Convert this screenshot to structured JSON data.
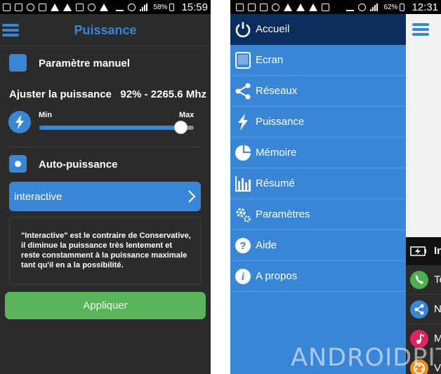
{
  "left_phone": {
    "status_bar": {
      "battery": "58%",
      "time": "15:59"
    },
    "app_bar": {
      "title": "Puissance"
    },
    "manual_option": {
      "label": "Paramètre manuel"
    },
    "power": {
      "label": "Ajuster la puissance",
      "value": "92% - 2265.6 Mhz",
      "slider_fraction": 0.92
    },
    "slider": {
      "min_label": "Min",
      "max_label": "Max"
    },
    "auto_option": {
      "label": "Auto-puissance"
    },
    "governor": {
      "selected": "interactive"
    },
    "description": "\"Interactive\" est le contraire de Conservative, il diminue la puissance très lentement et reste constamment à la puissance maximale tant qu'il en a la possibilité.",
    "apply_button": {
      "label": "Appliquer"
    }
  },
  "right_phone": {
    "status_bar": {
      "battery": "62%",
      "time": "12:31"
    },
    "drawer": {
      "items": [
        {
          "label": "Accueil",
          "icon": "power-icon"
        },
        {
          "label": "Ecran",
          "icon": "tablet-icon"
        },
        {
          "label": "Réseaux",
          "icon": "share-icon"
        },
        {
          "label": "Puissance",
          "icon": "bolt-icon"
        },
        {
          "label": "Mémoire",
          "icon": "pie-chart-icon"
        },
        {
          "label": "Résumé",
          "icon": "bar-chart-icon"
        },
        {
          "label": "Paramètres",
          "icon": "gears-icon"
        },
        {
          "label": "Aide",
          "icon": "help-icon"
        },
        {
          "label": "A propos",
          "icon": "info-icon"
        }
      ]
    },
    "underlay": {
      "section_text": "In",
      "rows": [
        {
          "text": "Te",
          "color": "#4caf50"
        },
        {
          "text": "N",
          "color": "#3a86d6"
        },
        {
          "text": "M",
          "color": "#e0245e"
        },
        {
          "text": "V",
          "color": "#f08c1a"
        }
      ]
    },
    "watermark": "ANDROIDPIT"
  },
  "colors": {
    "accent": "#3a86d6",
    "apply": "#5ab55a",
    "dark_bg": "#2b2b2b",
    "drawer_active": "#0b2d5e"
  }
}
